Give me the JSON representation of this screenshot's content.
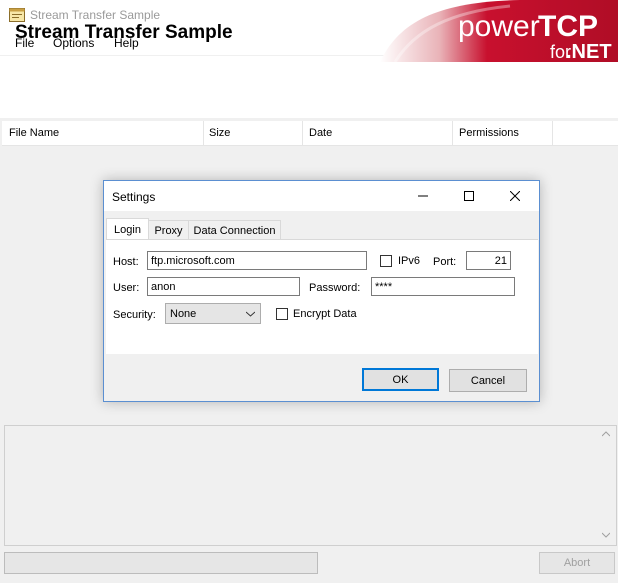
{
  "window": {
    "title": "Stream Transfer Sample",
    "icon": "app-window-icon"
  },
  "menu": {
    "items": [
      "File",
      "Options",
      "Help"
    ]
  },
  "banner": {
    "title": "Stream Transfer Sample",
    "logo_power": "power",
    "logo_tcp": "TCP",
    "logo_for": "for",
    "logo_net": ".NET"
  },
  "list": {
    "columns": [
      "File Name",
      "Size",
      "Date",
      "Permissions"
    ]
  },
  "footer": {
    "abort_label": "Abort"
  },
  "dialog": {
    "title": "Settings",
    "tabs": [
      "Login",
      "Proxy",
      "Data Connection"
    ],
    "active_tab": "Login",
    "host_label": "Host:",
    "host_value": "ftp.microsoft.com",
    "ipv6_label": "IPv6",
    "ipv6_checked": false,
    "port_label": "Port:",
    "port_value": "21",
    "user_label": "User:",
    "user_value": "anon",
    "password_label": "Password:",
    "password_value": "****",
    "security_label": "Security:",
    "security_value": "None",
    "encrypt_label": "Encrypt Data",
    "encrypt_checked": false,
    "ok_label": "OK",
    "cancel_label": "Cancel"
  },
  "colors": {
    "accent": "#0078d7",
    "logo_red": "#c8102e"
  }
}
